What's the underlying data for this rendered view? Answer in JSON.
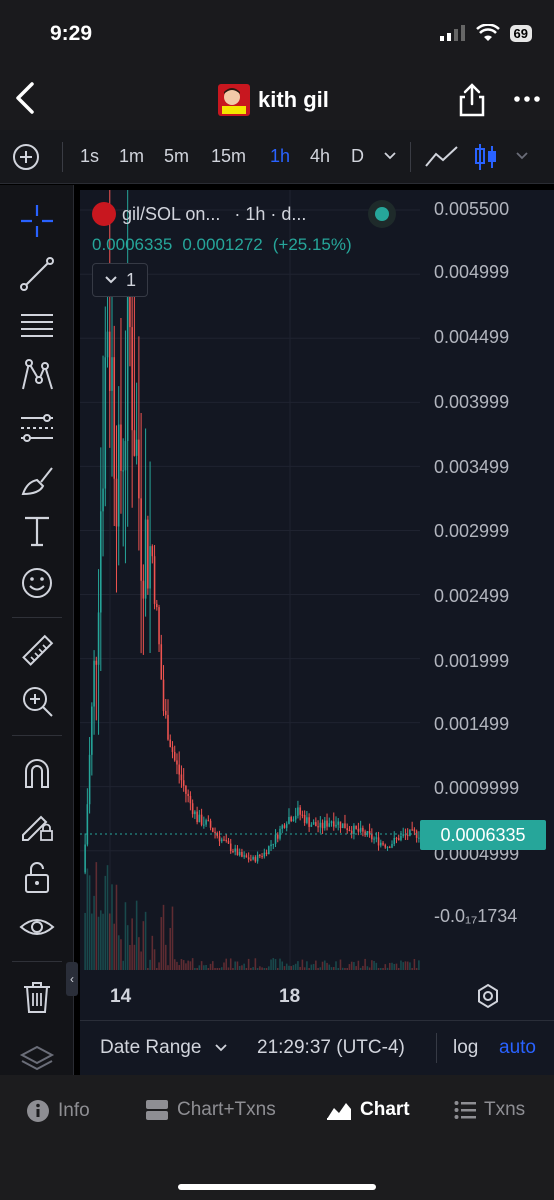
{
  "status": {
    "time": "9:29",
    "battery": "69"
  },
  "header": {
    "token_name": "kith gil"
  },
  "toolbar": {
    "intervals": [
      "1s",
      "1m",
      "5m",
      "15m",
      "1h",
      "4h",
      "D"
    ],
    "active_interval": "1h"
  },
  "legend": {
    "symbol": "gil/SOL on...",
    "interval_suffix": "· 1h · d...",
    "price": "0.0006335",
    "change": "0.0001272",
    "change_pct": "(+25.15%)",
    "indicators_count": "1"
  },
  "price_axis": {
    "labels": [
      "0.005500",
      "0.004999",
      "0.004499",
      "0.003999",
      "0.003499",
      "0.002999",
      "0.002499",
      "0.001999",
      "0.001499",
      "0.0009999",
      "0.0004999",
      "-0.0₁₇1734"
    ],
    "current_price": "0.0006335"
  },
  "time_axis": {
    "labels": [
      "14",
      "18"
    ]
  },
  "bottom": {
    "date_range": "Date Range",
    "time": "21:29:37 (UTC-4)",
    "log": "log",
    "auto": "auto"
  },
  "tabs": [
    {
      "label": "Info",
      "icon": "info-icon"
    },
    {
      "label": "Chart+Txns",
      "icon": "split-icon"
    },
    {
      "label": "Chart",
      "icon": "chart-icon"
    },
    {
      "label": "Txns",
      "icon": "list-icon"
    }
  ],
  "colors": {
    "up": "#26a69a",
    "down": "#ef5350",
    "accent": "#2962ff",
    "background": "#131722"
  },
  "chart_data": {
    "type": "candlestick",
    "title": "gil/SOL",
    "x_ticks": [
      "14",
      "18"
    ],
    "ylim": [
      -8e-05,
      0.0055
    ],
    "series": [
      {
        "name": "price_close",
        "values": [
          0.00055,
          0.0022,
          0.0048,
          0.0033,
          0.0045,
          0.003,
          0.0028,
          0.0016,
          0.0012,
          0.00095,
          0.00075,
          0.0007,
          0.0006,
          0.00052,
          0.00045,
          0.00043,
          0.00048,
          0.0006,
          0.00075,
          0.0008,
          0.00072,
          0.00068,
          0.00074,
          0.0007,
          0.00066,
          0.00063,
          0.00058,
          0.00054,
          0.0006,
          0.00063
        ]
      }
    ]
  }
}
